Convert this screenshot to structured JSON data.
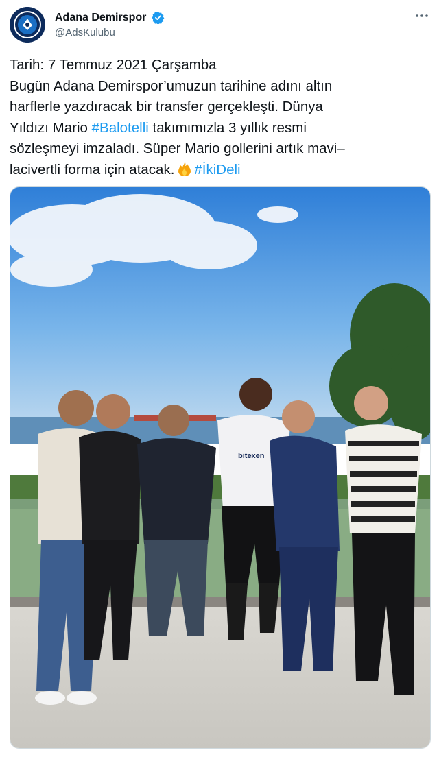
{
  "account": {
    "display_name": "Adana Demirspor",
    "handle": "@AdsKulubu",
    "verified": true,
    "avatar_icon": "club-crest-icon"
  },
  "tweet": {
    "line1": "Tarih: 7 Temmuz 2021 Çarşamba",
    "line2": "Bugün Adana Demirspor’umuzun tarihine adını altın",
    "line3": "harflerle yazdıracak bir transfer gerçekleşti. Dünya",
    "line4_before": "Yıldızı Mario ",
    "hashtag1": "#Balotelli",
    "line4_after": " takımımızla 3 yıllık resmi",
    "line5": "sözleşmeyi imzaladı. Süper Mario gollerini artık mavi–",
    "line6_before": "lacivertli forma için atacak.",
    "hashtag2": "#İkiDeli"
  },
  "photo": {
    "jersey_sponsor": "bitexen"
  },
  "colors": {
    "hashtag": "#1d9bf0",
    "verified": "#1d9bf0",
    "text": "#0f1419",
    "secondary": "#536471"
  }
}
